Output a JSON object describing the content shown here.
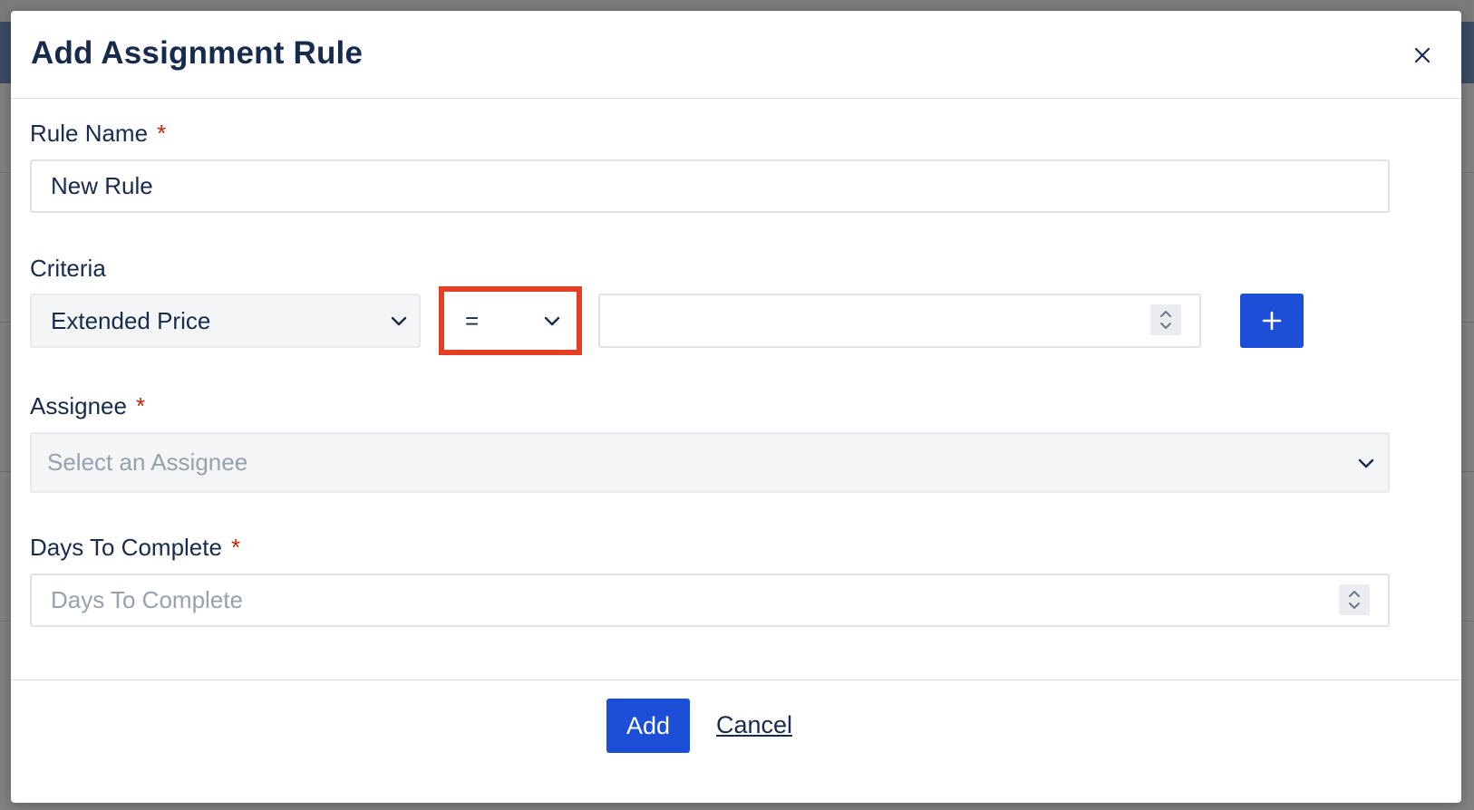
{
  "modal": {
    "title": "Add Assignment Rule",
    "close_icon": "close-icon"
  },
  "form": {
    "rule_name": {
      "label": "Rule Name",
      "required_mark": "*",
      "value": "New Rule"
    },
    "criteria": {
      "label": "Criteria",
      "field_select_value": "Extended Price",
      "operator_select_value": "=",
      "value_input": "",
      "add_icon": "plus-icon"
    },
    "assignee": {
      "label": "Assignee",
      "required_mark": "*",
      "placeholder": "Select an Assignee"
    },
    "days_to_complete": {
      "label": "Days To Complete",
      "required_mark": "*",
      "placeholder": "Days To Complete"
    }
  },
  "footer": {
    "add_label": "Add",
    "cancel_label": "Cancel"
  },
  "colors": {
    "primary": "#1d4ed8",
    "highlight": "#e43e24",
    "required": "#bf2600"
  }
}
